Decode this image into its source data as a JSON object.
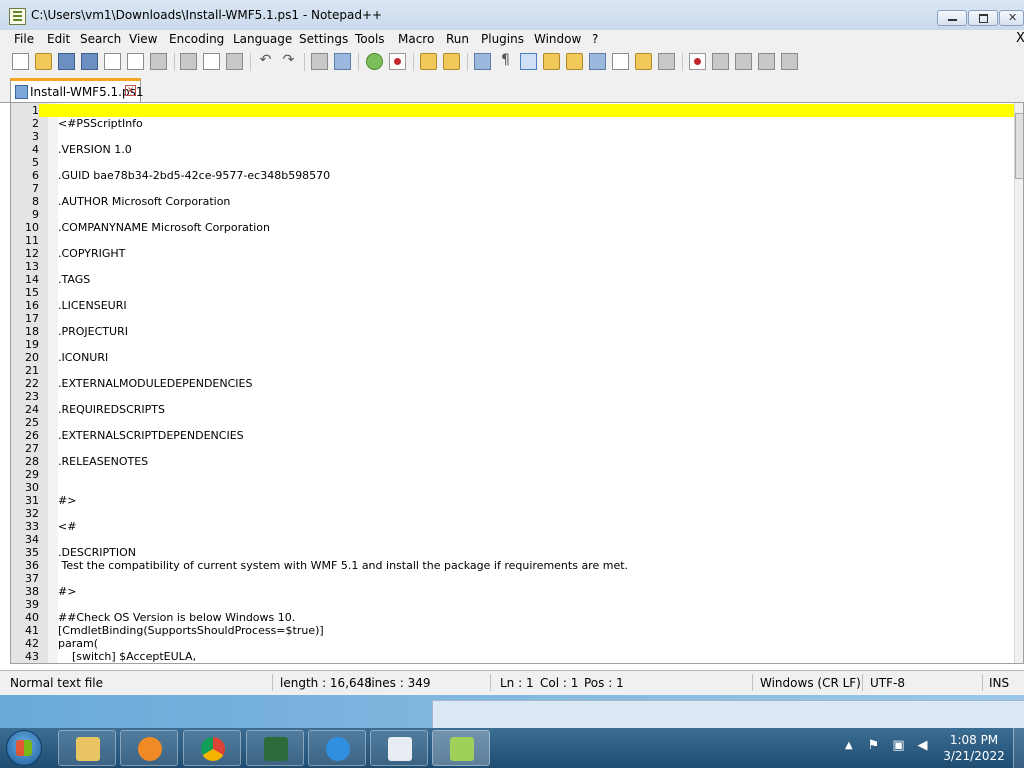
{
  "window": {
    "title": "C:\\Users\\vm1\\Downloads\\Install-WMF5.1.ps1 - Notepad++"
  },
  "menu": [
    "File",
    "Edit",
    "Search",
    "View",
    "Encoding",
    "Language",
    "Settings",
    "Tools",
    "Macro",
    "Run",
    "Plugins",
    "Window",
    "?"
  ],
  "menu_close": "X",
  "tab": {
    "label": "Install-WMF5.1.ps1"
  },
  "editor": {
    "current_line": 1,
    "lines": [
      {
        "n": "1",
        "t": ""
      },
      {
        "n": "2",
        "t": "<#PSScriptInfo"
      },
      {
        "n": "3",
        "t": ""
      },
      {
        "n": "4",
        "t": ".VERSION 1.0"
      },
      {
        "n": "5",
        "t": ""
      },
      {
        "n": "6",
        "t": ".GUID bae78b34-2bd5-42ce-9577-ec348b598570"
      },
      {
        "n": "7",
        "t": ""
      },
      {
        "n": "8",
        "t": ".AUTHOR Microsoft Corporation"
      },
      {
        "n": "9",
        "t": ""
      },
      {
        "n": "10",
        "t": ".COMPANYNAME Microsoft Corporation"
      },
      {
        "n": "11",
        "t": ""
      },
      {
        "n": "12",
        "t": ".COPYRIGHT"
      },
      {
        "n": "13",
        "t": ""
      },
      {
        "n": "14",
        "t": ".TAGS"
      },
      {
        "n": "15",
        "t": ""
      },
      {
        "n": "16",
        "t": ".LICENSEURI"
      },
      {
        "n": "17",
        "t": ""
      },
      {
        "n": "18",
        "t": ".PROJECTURI"
      },
      {
        "n": "19",
        "t": ""
      },
      {
        "n": "20",
        "t": ".ICONURI"
      },
      {
        "n": "21",
        "t": ""
      },
      {
        "n": "22",
        "t": ".EXTERNALMODULEDEPENDENCIES"
      },
      {
        "n": "23",
        "t": ""
      },
      {
        "n": "24",
        "t": ".REQUIREDSCRIPTS"
      },
      {
        "n": "25",
        "t": ""
      },
      {
        "n": "26",
        "t": ".EXTERNALSCRIPTDEPENDENCIES"
      },
      {
        "n": "27",
        "t": ""
      },
      {
        "n": "28",
        "t": ".RELEASENOTES"
      },
      {
        "n": "29",
        "t": ""
      },
      {
        "n": "30",
        "t": ""
      },
      {
        "n": "31",
        "t": "#>"
      },
      {
        "n": "32",
        "t": ""
      },
      {
        "n": "33",
        "t": "<#"
      },
      {
        "n": "34",
        "t": ""
      },
      {
        "n": "35",
        "t": ".DESCRIPTION"
      },
      {
        "n": "36",
        "t": " Test the compatibility of current system with WMF 5.1 and install the package if requirements are met."
      },
      {
        "n": "37",
        "t": ""
      },
      {
        "n": "38",
        "t": "#>"
      },
      {
        "n": "39",
        "t": ""
      },
      {
        "n": "40",
        "t": "##Check OS Version is below Windows 10."
      },
      {
        "n": "41",
        "t": "[CmdletBinding(SupportsShouldProcess=$true)]"
      },
      {
        "n": "42",
        "t": "param("
      },
      {
        "n": "43",
        "t": "    [switch] $AcceptEULA,"
      }
    ]
  },
  "status": {
    "file_type": "Normal text file",
    "length": "length : 16,648",
    "lines": "lines : 349",
    "ln": "Ln : 1",
    "col": "Col : 1",
    "pos": "Pos : 1",
    "eol": "Windows (CR LF)",
    "encoding": "UTF-8",
    "mode": "INS"
  },
  "taskbar": {
    "time": "1:08 PM",
    "date": "3/21/2022"
  }
}
